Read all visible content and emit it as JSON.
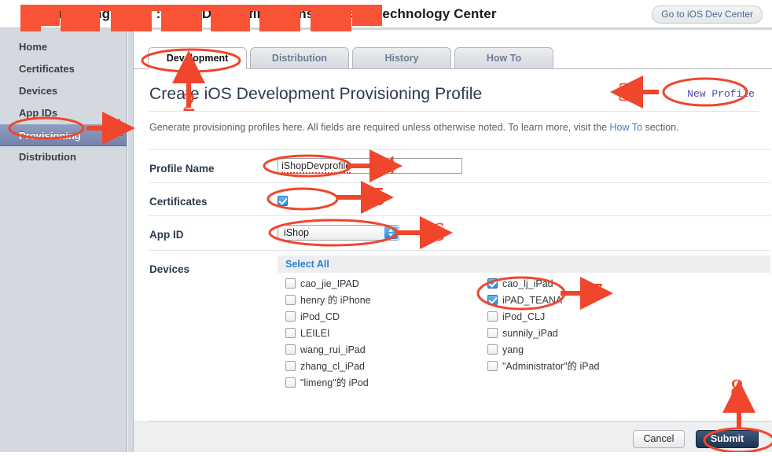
{
  "topbar": {
    "title": "Provisioning Portal : iShopDevprofile : Consistency & technology Center",
    "title_redacted": true,
    "dev_center_button": "Go to iOS Dev Center"
  },
  "sidebar": {
    "items": [
      {
        "label": "Home",
        "selected": false
      },
      {
        "label": "Certificates",
        "selected": false
      },
      {
        "label": "Devices",
        "selected": false
      },
      {
        "label": "App IDs",
        "selected": false
      },
      {
        "label": "Provisioning",
        "selected": true
      },
      {
        "label": "Distribution",
        "selected": false
      }
    ]
  },
  "tabs": [
    {
      "label": "Development",
      "active": true
    },
    {
      "label": "Distribution",
      "active": false
    },
    {
      "label": "History",
      "active": false
    },
    {
      "label": "How To",
      "active": false
    }
  ],
  "content": {
    "page_title": "Create iOS Development Provisioning Profile",
    "new_profile_link": "New Profile",
    "description_before": "Generate provisioning profiles here. All fields are required unless otherwise noted. To learn more, visit the ",
    "description_link": "How To",
    "description_after": " section."
  },
  "form": {
    "profile_name": {
      "label": "Profile Name",
      "value": "iShopDevprofile",
      "placeholder": ""
    },
    "certificates": {
      "label": "Certificates",
      "items": [
        {
          "name_redacted": true,
          "checked": true
        }
      ]
    },
    "app_id": {
      "label": "App ID",
      "selected": "iShop",
      "options": [
        "iShop"
      ]
    },
    "devices": {
      "label": "Devices",
      "select_all": "Select All",
      "column_left": [
        {
          "name": "cao_jie_IPAD",
          "checked": false
        },
        {
          "name": "henry 的 iPhone",
          "checked": false
        },
        {
          "name": "iPod_CD",
          "checked": false
        },
        {
          "name": "LEILEI",
          "checked": false
        },
        {
          "name": "wang_rui_iPad",
          "checked": false
        },
        {
          "name": "zhang_cl_iPad",
          "checked": false
        },
        {
          "name": "\"limeng\"的 iPod",
          "checked": false
        }
      ],
      "column_right": [
        {
          "name": "cao_lj_iPad",
          "checked": true
        },
        {
          "name": "iPAD_TEANA",
          "checked": true
        },
        {
          "name": "iPod_CLJ",
          "checked": false
        },
        {
          "name": "sunnily_iPad",
          "checked": false
        },
        {
          "name": "yang",
          "checked": false
        },
        {
          "name": "\"Administrator\"的 iPad",
          "checked": false
        }
      ]
    }
  },
  "footer": {
    "cancel": "Cancel",
    "submit": "Submit"
  },
  "annotations": {
    "color": "#f0462c",
    "steps": [
      {
        "number": "1",
        "target": "sidebar-item-provisioning"
      },
      {
        "number": "2",
        "target": "tab-development"
      },
      {
        "number": "3",
        "target": "new-profile-link"
      },
      {
        "number": "4",
        "target": "profile-name-input"
      },
      {
        "number": "5",
        "target": "certificate-checkbox"
      },
      {
        "number": "6",
        "target": "app-id-select"
      },
      {
        "number": "7",
        "target": "device-checkboxes"
      },
      {
        "number": "8",
        "target": "submit-button"
      }
    ]
  }
}
